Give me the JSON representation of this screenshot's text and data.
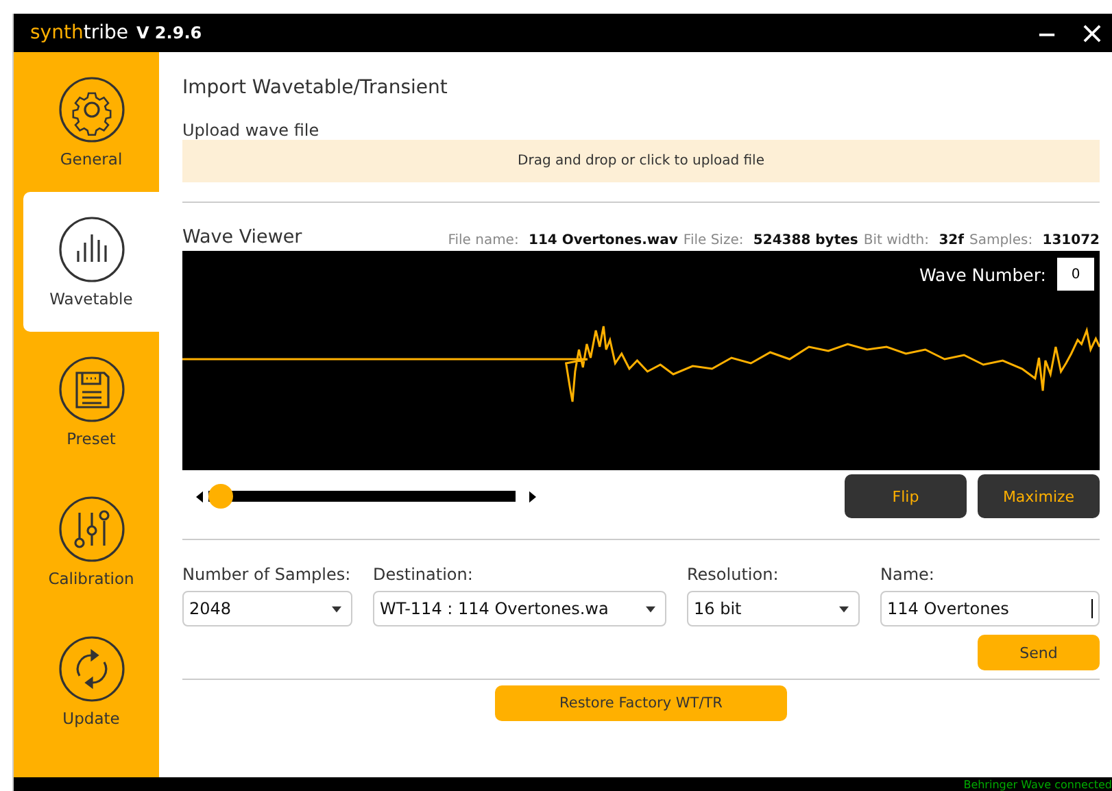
{
  "window": {
    "logo_first": "synth",
    "logo_second": "tribe",
    "version": "V 2.9.6",
    "controls": [
      {
        "kind": "minimize"
      },
      {
        "kind": "close"
      }
    ]
  },
  "sidebar": {
    "items": [
      {
        "label": "General",
        "selected": false
      },
      {
        "label": "Wavetable",
        "selected": true
      },
      {
        "label": "Preset",
        "selected": false
      },
      {
        "label": "Calibration",
        "selected": false
      },
      {
        "label": "Update",
        "selected": false
      }
    ]
  },
  "heading": "Import Wavetable/Transient",
  "upload": {
    "label": "Upload wave file",
    "dropzone": "Drag and drop or click to upload file"
  },
  "viewer": {
    "title": "Wave Viewer",
    "info": [
      {
        "label": "File name:",
        "value": "114 Overtones.wav"
      },
      {
        "label": "File Size:",
        "value": "524388 bytes"
      },
      {
        "label": "Bit width:",
        "value": "32f"
      },
      {
        "label": "Samples:",
        "value": "131072"
      }
    ],
    "wave_number_label": "Wave Number:",
    "wave_number": "0",
    "slider": {
      "level": 0
    },
    "buttons": [
      "Flip",
      "Maximize"
    ]
  },
  "fields": [
    {
      "label": "Number of Samples:",
      "value": "2048",
      "kind": "select"
    },
    {
      "label": "Destination:",
      "value": "WT-114 :  114 Overtones.wa",
      "kind": "select"
    },
    {
      "label": "Resolution:",
      "value": "16 bit",
      "kind": "select"
    },
    {
      "label": "Name:",
      "value": "114 Overtones",
      "kind": "text"
    }
  ],
  "send_button": "Send",
  "restore_button": "Restore Factory WT/TR",
  "status_bar": "Behringer Wave connected"
}
